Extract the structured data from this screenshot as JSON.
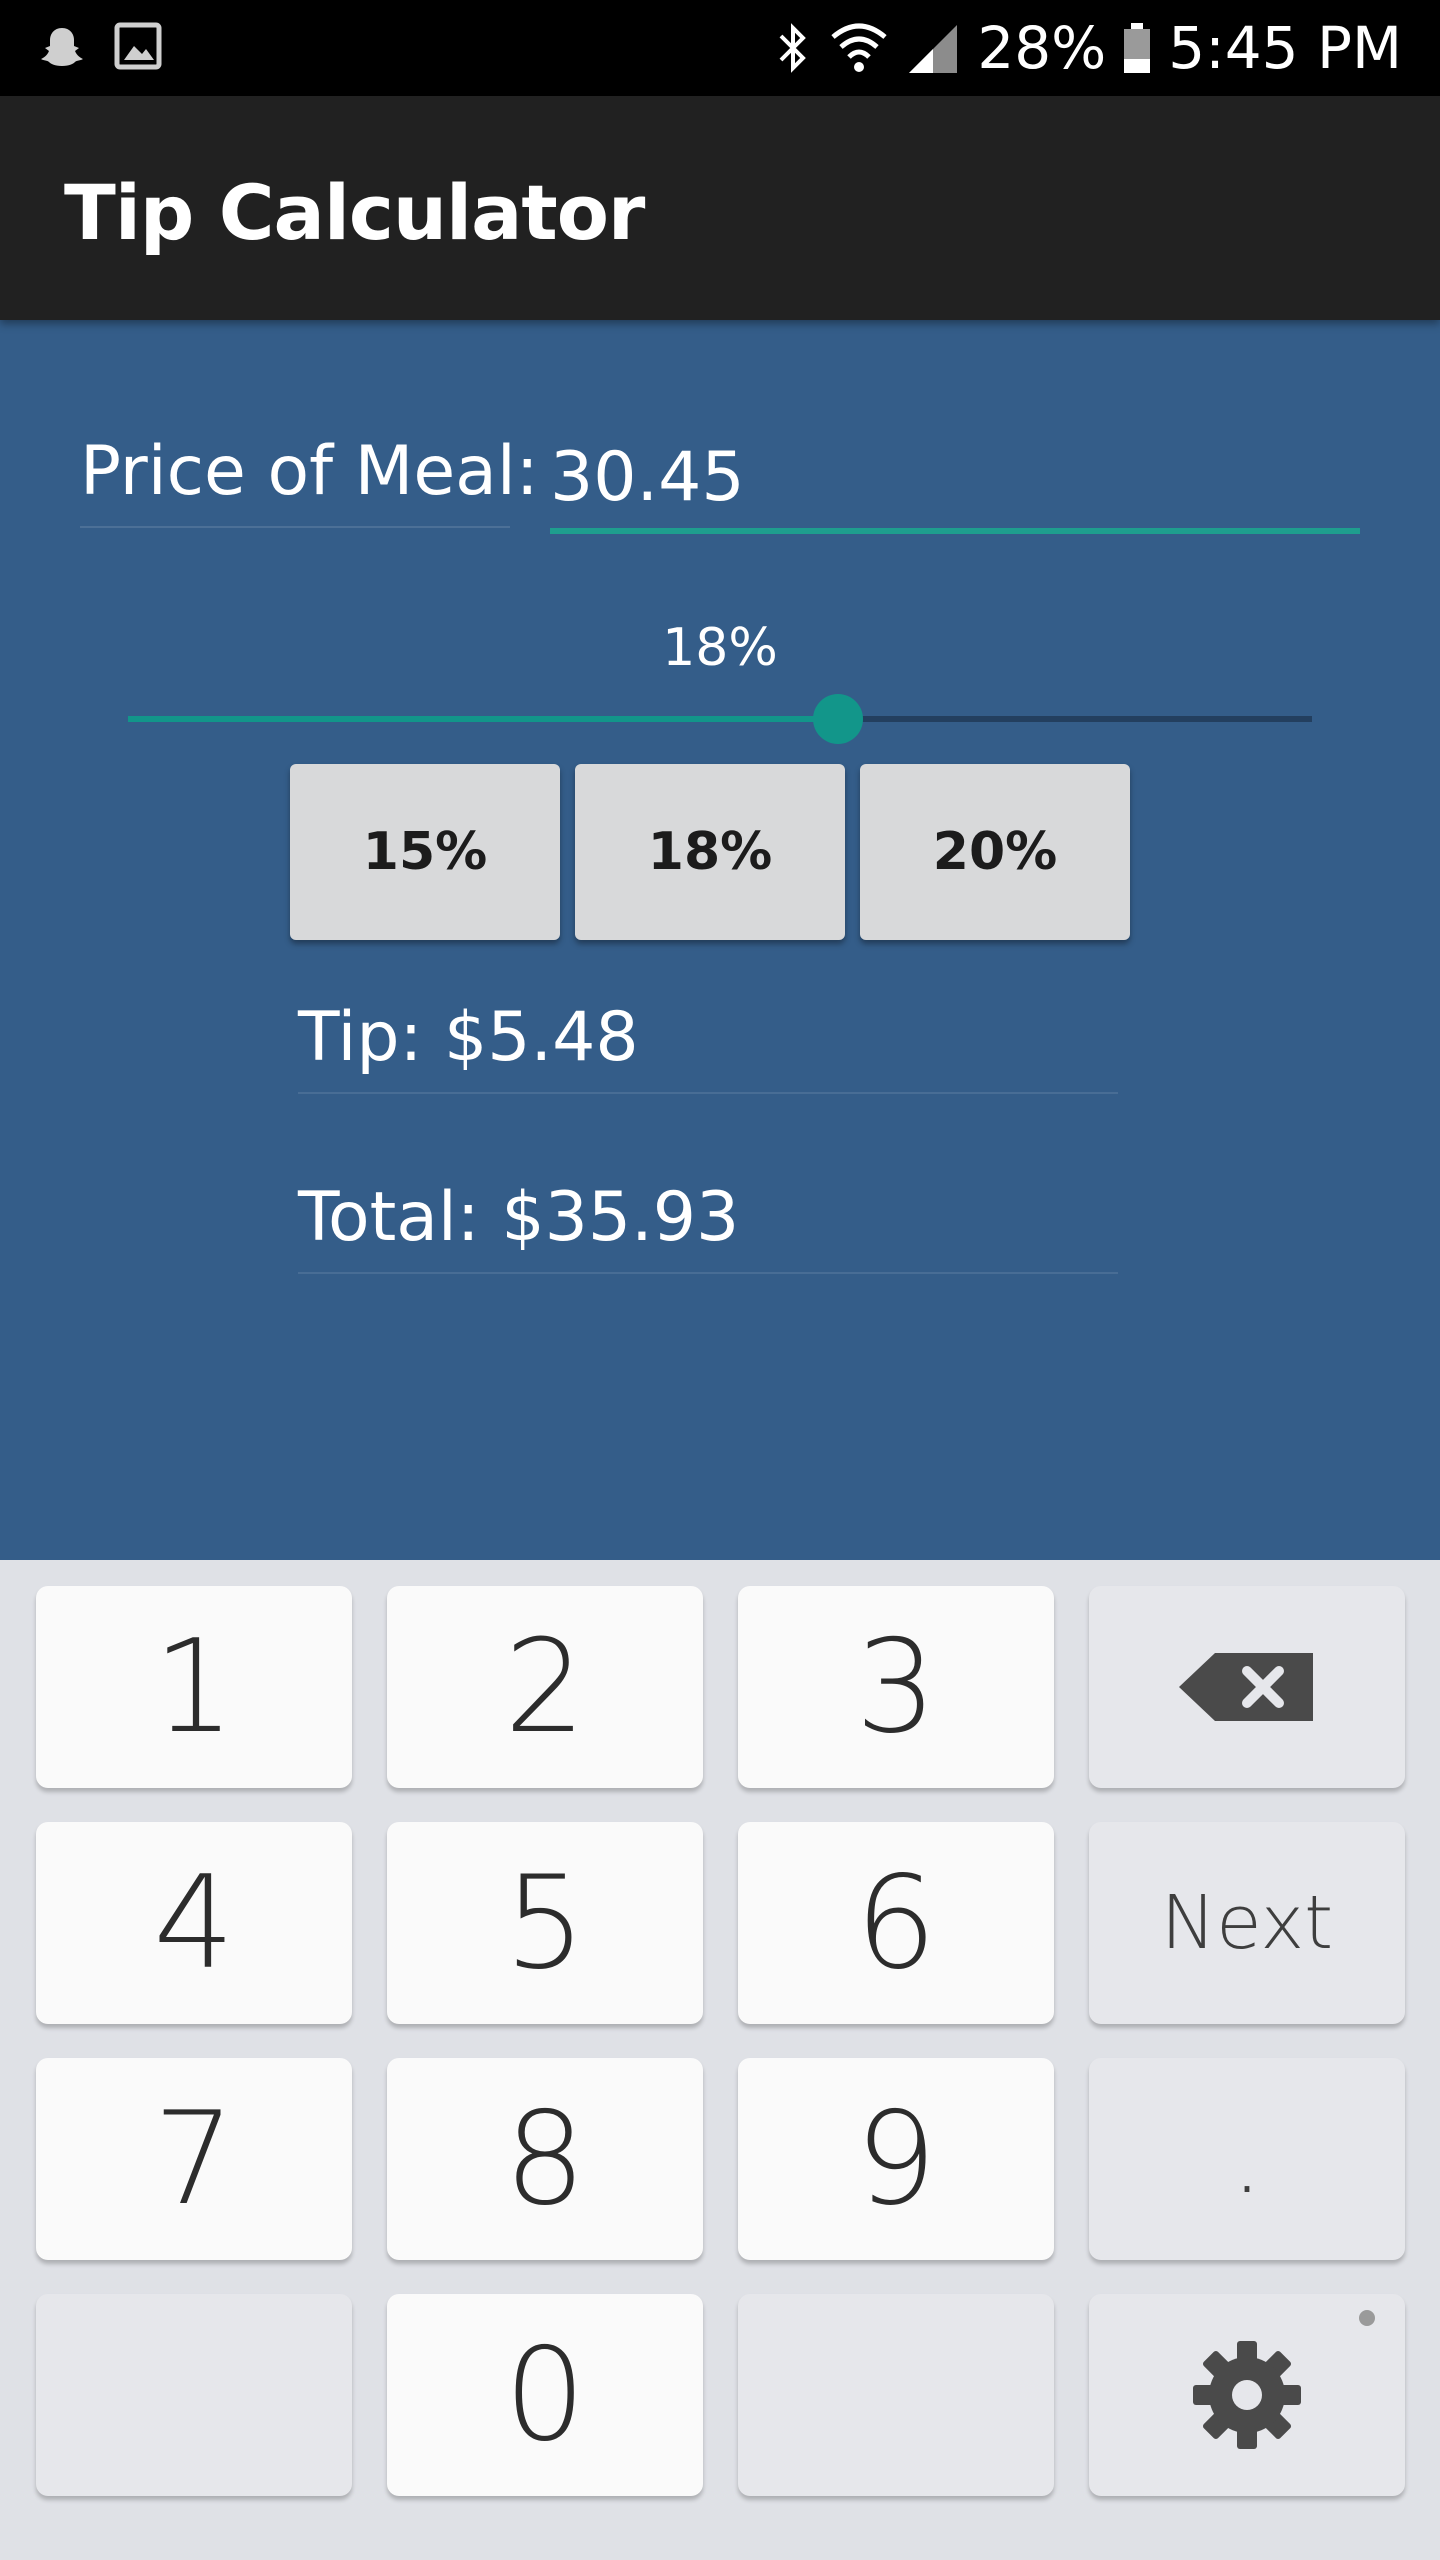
{
  "status_bar": {
    "icons": [
      "snapchat-icon",
      "gallery-icon",
      "bluetooth-icon",
      "wifi-icon",
      "signal-icon",
      "battery-icon"
    ],
    "battery": "28%",
    "time": "5:45 PM"
  },
  "app_bar": {
    "title": "Tip Calculator"
  },
  "form": {
    "price_label": "Price of Meal:",
    "price_value": "30.45",
    "tip_percent_label": "18%",
    "tip_percent_value": 18,
    "tip_percent_max": 30,
    "buttons": [
      "15%",
      "18%",
      "20%"
    ],
    "tip_text": "Tip: $5.48",
    "total_text": "Total: $35.93"
  },
  "keyboard": {
    "keys": [
      "1",
      "2",
      "3",
      "4",
      "5",
      "6",
      "7",
      "8",
      "9",
      "0"
    ],
    "next_label": "Next",
    "dot_label": ".",
    "icons": [
      "backspace-icon",
      "gear-icon"
    ]
  },
  "colors": {
    "background": "#345d89",
    "app_bar": "#212121",
    "accent": "#12968a",
    "keyboard_bg": "#dfe1e6"
  }
}
